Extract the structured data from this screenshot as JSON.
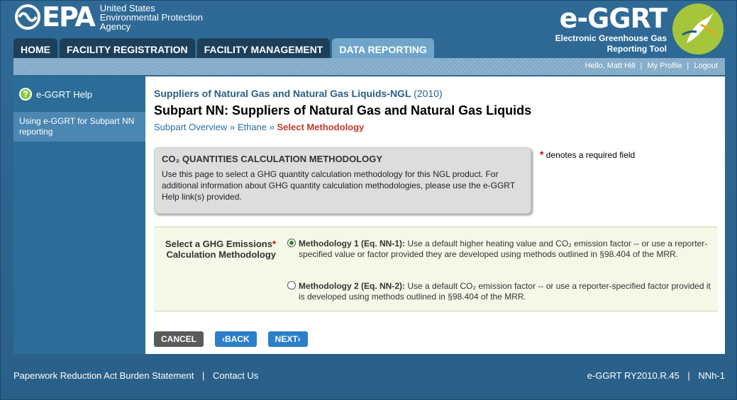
{
  "header": {
    "epa_word": "EPA",
    "epa_sub_lines": [
      "United States",
      "Environmental Protection",
      "Agency"
    ],
    "brand_title": "e-GGRT",
    "brand_sub_line1": "Electronic Greenhouse Gas",
    "brand_sub_line2": "Reporting Tool"
  },
  "tabs": [
    {
      "label": "HOME"
    },
    {
      "label": "FACILITY REGISTRATION"
    },
    {
      "label": "FACILITY MANAGEMENT"
    },
    {
      "label": "DATA REPORTING"
    }
  ],
  "userbar": {
    "greeting": "Hello, Matt Hill",
    "profile": "My Profile",
    "logout": "Logout"
  },
  "sidebar": {
    "help_label": "e-GGRT Help",
    "item_label": "Using e-GGRT for Subpart NN reporting"
  },
  "page": {
    "supplier_title": "Suppliers of Natural Gas and Natural Gas Liquids-NGL",
    "year": "(2010)",
    "heading": "Subpart NN: Suppliers of Natural Gas and Natural Gas Liquids",
    "crumb1": "Subpart Overview",
    "crumb2": "Ethane",
    "crumb_current": "Select Methodology",
    "crumb_sep": "»"
  },
  "infobox": {
    "title": "CO₂ QUANTITIES CALCULATION METHODOLOGY",
    "text": "Use this page to select a GHG quantity calculation methodology for this NGL product. For additional information about GHG quantity calculation methodologies, please use the e-GGRT Help link(s) provided."
  },
  "required_note": "denotes a required field",
  "form": {
    "label_line1": "Select a GHG Emissions",
    "label_line2": "Calculation Methodology",
    "option1_title": "Methodology 1 (Eq. NN-1):",
    "option1_text": "Use a default higher heating value and CO₂ emission factor -- or use a reporter-specified value or factor provided they are developed using methods outlined in §98.404 of the MRR.",
    "option2_title": "Methodology 2 (Eq. NN-2):",
    "option2_text": "Use a default CO₂ emission factor -- or use a reporter-specified factor provided it is developed using methods outlined in §98.404 of the MRR."
  },
  "buttons": {
    "cancel": "CANCEL",
    "back": "‹BACK",
    "next": "NEXT›"
  },
  "footer": {
    "paperwork": "Paperwork Reduction Act Burden Statement",
    "contact": "Contact Us",
    "version": "e-GGRT RY2010.R.45",
    "page_id": "NNh-1"
  }
}
